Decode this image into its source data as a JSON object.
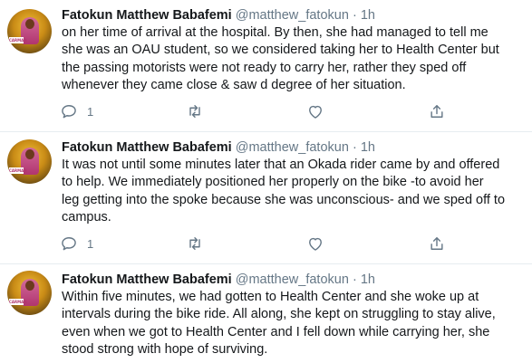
{
  "tweets": [
    {
      "author": {
        "name": "Fatokun Matthew Babafemi",
        "handle": "@matthew_fatokun",
        "separator": "·",
        "time": "1h",
        "avatar_badge": "CARMAN"
      },
      "lines": [
        "on her time of arrival at the hospital. By then, she had managed to tell me",
        "she was an OAU student, so we considered taking her to Health Center but",
        "the passing motorists were not ready to carry her, rather they sped off",
        "whenever they came close & saw d degree of her situation."
      ],
      "actions": {
        "reply_count": "1",
        "retweet_count": "",
        "like_count": ""
      }
    },
    {
      "author": {
        "name": "Fatokun Matthew Babafemi",
        "handle": "@matthew_fatokun",
        "separator": "·",
        "time": "1h",
        "avatar_badge": "CARMAN"
      },
      "lines": [
        "It was not until some minutes later that an Okada rider came by and offered",
        "to help. We immediately positioned her properly on the bike -to avoid her",
        "leg getting into the spoke because she was unconscious- and we sped off to",
        "campus."
      ],
      "actions": {
        "reply_count": "1",
        "retweet_count": "",
        "like_count": ""
      }
    },
    {
      "author": {
        "name": "Fatokun Matthew Babafemi",
        "handle": "@matthew_fatokun",
        "separator": "·",
        "time": "1h",
        "avatar_badge": "CARMAN"
      },
      "lines": [
        "Within five minutes, we had gotten to Health Center and she woke up at",
        "intervals during the bike ride. All along, she kept on struggling to stay alive,",
        "even when we got to Health Center and I fell down while carrying her, she",
        "stood strong with hope of surviving."
      ]
    }
  ],
  "icons": {
    "reply": "reply-icon",
    "retweet": "retweet-icon",
    "like": "heart-icon",
    "share": "share-icon"
  },
  "colors": {
    "text": "#14171a",
    "muted": "#657786",
    "divider": "#e6ecf0"
  }
}
